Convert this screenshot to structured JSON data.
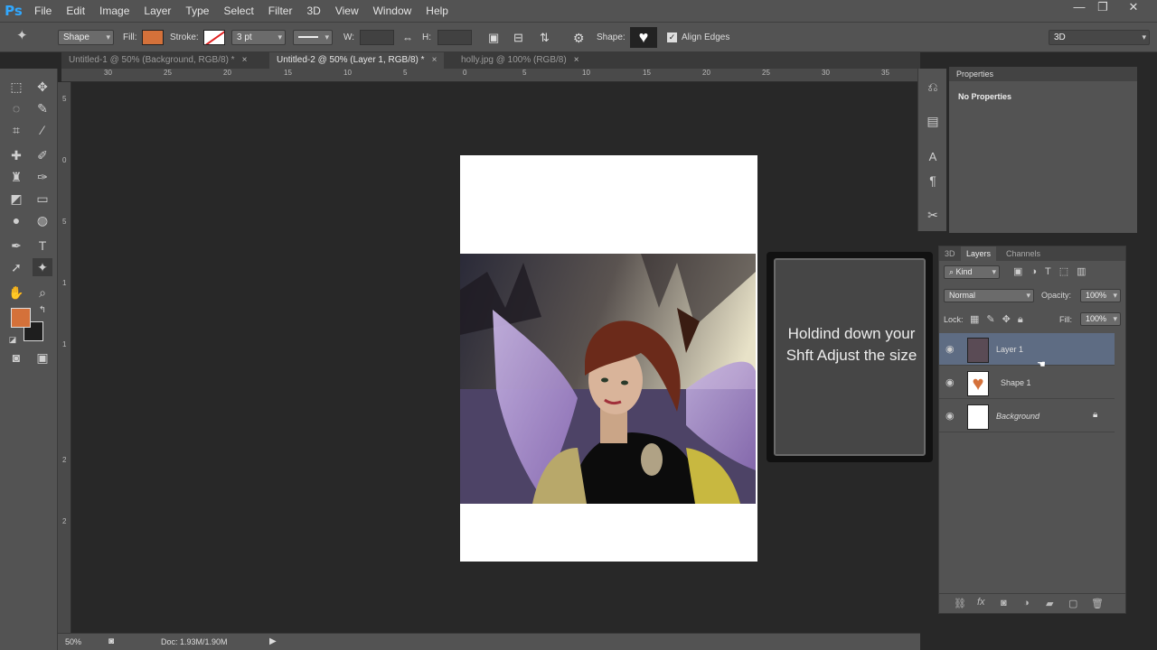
{
  "app": {
    "logo": "Ps"
  },
  "menu": [
    "File",
    "Edit",
    "Image",
    "Layer",
    "Type",
    "Select",
    "Filter",
    "3D",
    "View",
    "Window",
    "Help"
  ],
  "window_controls": {
    "minimize": "—",
    "restore": "❐",
    "close": "✕"
  },
  "options": {
    "tool_mode": "Shape",
    "fill_label": "Fill:",
    "fill_color": "#d4713a",
    "stroke_label": "Stroke:",
    "stroke_width": "3 pt",
    "w_label": "W:",
    "h_label": "H:",
    "shape_label": "Shape:",
    "align_edges": "Align Edges",
    "workspace": "3D"
  },
  "tabs": [
    {
      "label": "Untitled-1 @ 50% (Background, RGB/8) *",
      "close": "×"
    },
    {
      "label": "Untitled-2 @ 50% (Layer 1, RGB/8) *",
      "close": "×"
    },
    {
      "label": "holly.jpg @ 100% (RGB/8)",
      "close": "×"
    }
  ],
  "ruler_top": [
    "30",
    "25",
    "20",
    "15",
    "10",
    "5",
    "0",
    "5",
    "10",
    "15",
    "20",
    "25",
    "30",
    "35"
  ],
  "ruler_left": [
    "5",
    "0",
    "5",
    "1",
    "1",
    "2",
    "2"
  ],
  "colors": {
    "foreground": "#d4713a",
    "background": "#1e1e1e"
  },
  "tooltip": {
    "text": "Holdind down your Shft Adjust the size"
  },
  "status": {
    "zoom": "50%",
    "doc": "Doc: 1.93M/1.90M"
  },
  "properties": {
    "title": "Properties",
    "message": "No Properties"
  },
  "layers_panel": {
    "tabs": [
      "3D",
      "Layers",
      "Channels"
    ],
    "filter": "Kind",
    "blend_mode": "Normal",
    "opacity_label": "Opacity:",
    "opacity": "100%",
    "lock_label": "Lock:",
    "fill_label": "Fill:",
    "fill": "100%",
    "layers": [
      {
        "name": "Layer 1",
        "selected": true
      },
      {
        "name": "Shape 1",
        "selected": false
      },
      {
        "name": "Background",
        "selected": false
      }
    ]
  }
}
